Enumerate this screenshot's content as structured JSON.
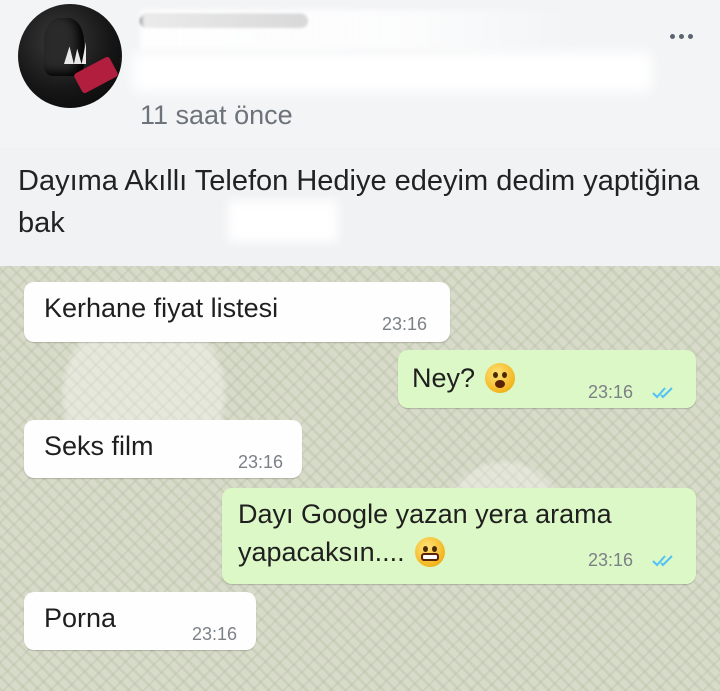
{
  "post": {
    "timestamp": "11 saat önce",
    "caption": "Dayıma Akıllı Telefon Hediye  edeyim dedim yaptiğina bak"
  },
  "chat": {
    "messages": [
      {
        "direction": "incoming",
        "text": "Kerhane fiyat listesi",
        "time": "23:16"
      },
      {
        "direction": "outgoing",
        "text": "Ney?",
        "emoji": "shocked-face-icon",
        "time": "23:16",
        "status": "read"
      },
      {
        "direction": "incoming",
        "text": "Seks film",
        "time": "23:16"
      },
      {
        "direction": "outgoing",
        "text_line1": "Dayı Google yazan yera arama",
        "text_line2": "yapacaksın....",
        "emoji": "grimacing-face-icon",
        "time": "23:16",
        "status": "read"
      },
      {
        "direction": "incoming",
        "text": "Porna",
        "time": "23:16"
      }
    ]
  },
  "colors": {
    "incoming_bubble": "#fefefe",
    "outgoing_bubble": "#dcf8c6",
    "read_ticks": "#4fc3f7"
  }
}
